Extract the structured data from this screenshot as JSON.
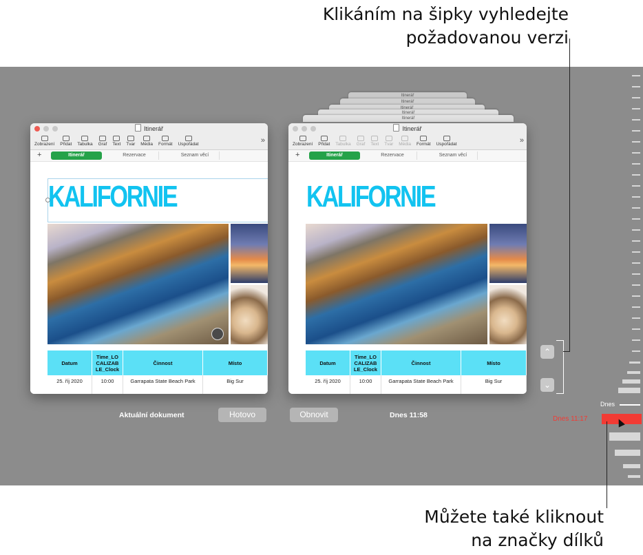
{
  "callouts": {
    "top": [
      "Klikáním na šipky vyhledejte",
      "požadovanou verzi"
    ],
    "bottom": [
      "Můžete také kliknout",
      "na značky dílků"
    ]
  },
  "window": {
    "title": "Itinerář",
    "toolbar": [
      {
        "label": "Zobrazení",
        "icon": "sidebar-icon"
      },
      {
        "label": "Přidat",
        "icon": "add-icon"
      },
      {
        "label": "Tabulka",
        "icon": "table-icon"
      },
      {
        "label": "Graf",
        "icon": "chart-icon"
      },
      {
        "label": "Text",
        "icon": "text-icon"
      },
      {
        "label": "Tvar",
        "icon": "shape-icon"
      },
      {
        "label": "Média",
        "icon": "media-icon"
      },
      {
        "label": "Formát",
        "icon": "format-icon"
      },
      {
        "label": "Uspořádat",
        "icon": "arrange-icon"
      }
    ],
    "more": "»",
    "add_sheet": "+",
    "sheets": [
      "Itinerář",
      "Rezervace",
      "Seznam věcí"
    ],
    "heading": "KALIFORNIE",
    "table": {
      "headers": [
        "Datum",
        "Time_LO CALIZAB LE_Clock",
        "Činnost",
        "Místo"
      ],
      "row": [
        "25. říj 2020",
        "10:00",
        "Garrapata State Beach Park",
        "Big Sur"
      ]
    }
  },
  "stack_titles": [
    "Itinerář",
    "Itinerář",
    "Itinerář",
    "Itinerář",
    "Itinerář"
  ],
  "bottom_bar": {
    "current_label": "Aktuální dokument",
    "done_button": "Hotovo",
    "restore_button": "Obnovit",
    "version_time": "Dnes 11:58"
  },
  "timeline": {
    "today_label": "Dnes",
    "current_marker": "Dnes 11:17"
  },
  "nav_arrows": {
    "up": "⌃",
    "down": "⌄"
  },
  "colors": {
    "accent_tab": "#25a249",
    "heading": "#12c3f0",
    "table_header": "#5be0f6",
    "timeline_marker": "#f23b34",
    "backdrop": "#8c8c8c"
  }
}
